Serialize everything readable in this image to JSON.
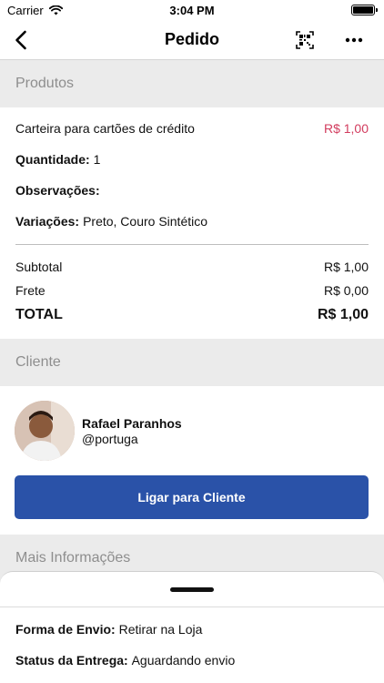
{
  "status_bar": {
    "carrier": "Carrier",
    "time": "3:04 PM"
  },
  "nav": {
    "title": "Pedido",
    "back_icon": "chevron-left-icon",
    "qr_icon": "qr-code-icon",
    "more_icon": "more-dots-icon"
  },
  "products_section": {
    "header": "Produtos",
    "item_name": "Carteira para cartões de crédito",
    "item_price": "R$ 1,00",
    "quantity_label": "Quantidade:",
    "quantity_value": "1",
    "notes_label": "Observações:",
    "notes_value": "",
    "variations_label": "Variações:",
    "variations_value": "Preto, Couro Sintético"
  },
  "totals": {
    "subtotal_label": "Subtotal",
    "subtotal_value": "R$ 1,00",
    "shipping_label": "Frete",
    "shipping_value": "R$ 0,00",
    "total_label": "TOTAL",
    "total_value": "R$ 1,00"
  },
  "client_section": {
    "header": "Cliente",
    "name": "Rafael Paranhos",
    "handle": "@portuga",
    "call_button": "Ligar para Cliente"
  },
  "more_info_section": {
    "header": "Mais Informações",
    "shipping_method_label": "Forma de Envio:",
    "shipping_method_value": "Retirar na Loja",
    "delivery_status_label": "Status da Entrega:",
    "delivery_status_value": "Aguardando envio"
  },
  "colors": {
    "accent": "#2a52a8",
    "price": "#d23c5e",
    "section_bg": "#ebebeb"
  }
}
